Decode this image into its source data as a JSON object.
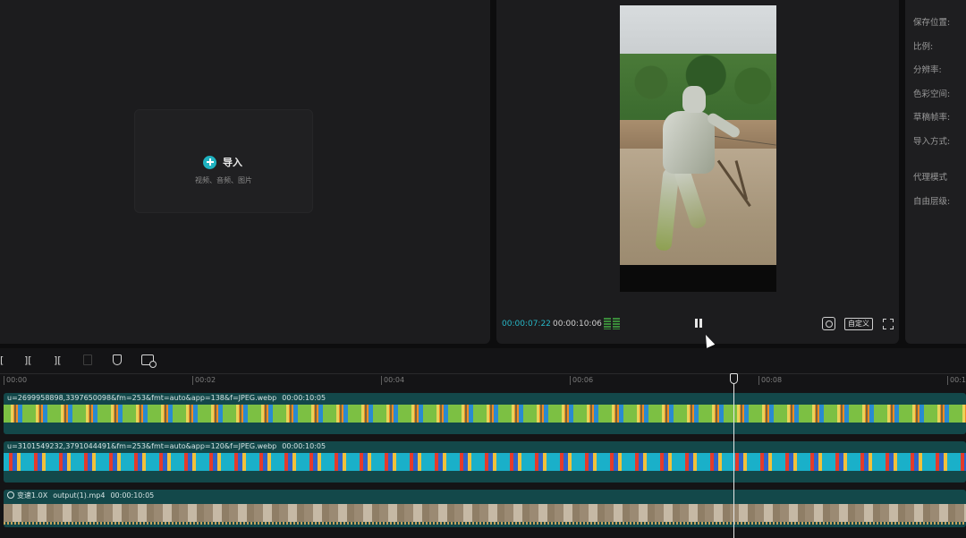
{
  "media": {
    "import_label": "导入",
    "import_sub": "视频、音频、图片"
  },
  "player": {
    "current_time": "00:00:07:22",
    "total_time": "00:00:10:06",
    "ratio_label": "自定义"
  },
  "properties": {
    "items": [
      "保存位置:",
      "比例:",
      "分辨率:",
      "色彩空间:",
      "草稿帧率:",
      "导入方式:",
      "代理模式",
      "自由层级:"
    ]
  },
  "toolbar": {
    "tools": [
      "[",
      "][",
      "]["
    ]
  },
  "ruler": {
    "ticks": [
      "00:00",
      "00:02",
      "00:04",
      "00:06",
      "00:08",
      "00:1"
    ]
  },
  "tracks": [
    {
      "name": "u=2699958898,3397650098&fm=253&fmt=auto&app=138&f=JPEG.webp",
      "duration": "00:00:10:05"
    },
    {
      "name": "u=3101549232,3791044491&fm=253&fmt=auto&app=120&f=JPEG.webp",
      "duration": "00:00:10:05"
    },
    {
      "speed": "变速1.0X",
      "name": "output(1).mp4",
      "duration": "00:00:10:05"
    }
  ],
  "colors": {
    "accent": "#1fb2c0",
    "track": "#13484a",
    "panel": "#1c1c1e"
  }
}
